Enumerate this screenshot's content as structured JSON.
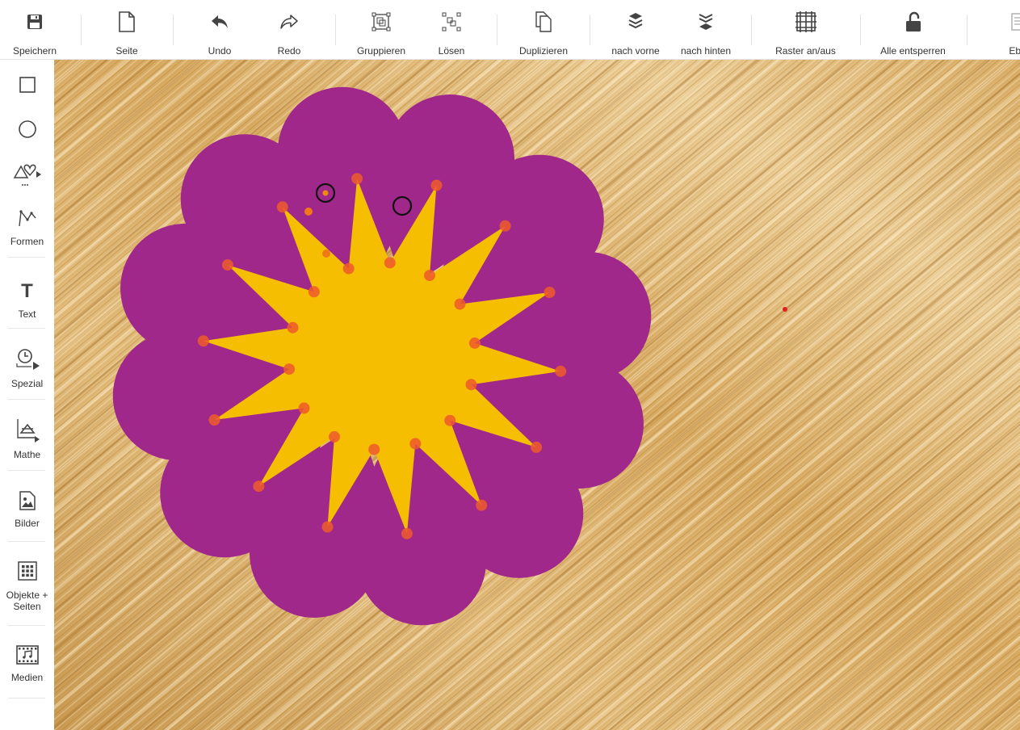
{
  "toolbar": {
    "save": "Speichern",
    "page": "Seite",
    "undo": "Undo",
    "redo": "Redo",
    "group": "Gruppieren",
    "ungroup": "Lösen",
    "duplicate": "Duplizieren",
    "bring_forward": "nach vorne",
    "send_backward": "nach hinten",
    "grid_toggle": "Raster an/aus",
    "unlock_all": "Alle entsperren",
    "layers": "Ebe"
  },
  "sidebar": {
    "forms": "Formen",
    "text": "Text",
    "text_glyph": "T",
    "special": "Spezial",
    "math": "Mathe",
    "images": "Bilder",
    "objects_line1": "Objekte +",
    "objects_line2": "Seiten",
    "media": "Medien"
  },
  "colors": {
    "petal": "#a0288a",
    "star": "#f6be00",
    "handle": "#ef5a2a",
    "wood_light": "#e8c48a",
    "wood_dark": "#c08a3a",
    "icon": "#444444"
  }
}
